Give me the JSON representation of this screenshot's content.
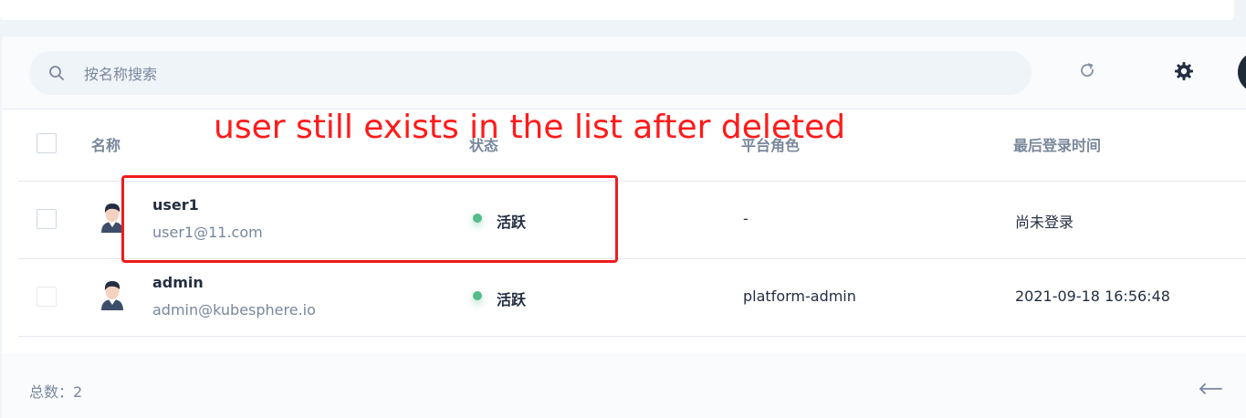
{
  "toolbar": {
    "search_placeholder": "按名称搜索"
  },
  "table": {
    "columns": [
      "名称",
      "状态",
      "平台角色",
      "最后登录时间"
    ],
    "rows": [
      {
        "name": "user1",
        "email": "user1@11.com",
        "status": "活跃",
        "role": "-",
        "last_login": "尚未登录"
      },
      {
        "name": "admin",
        "email": "admin@kubesphere.io",
        "status": "活跃",
        "role": "platform-admin",
        "last_login": "2021-09-18 16:56:48"
      }
    ]
  },
  "footer": {
    "total_label": "总数：2"
  },
  "annotation": {
    "text": "user still exists in the list after deleted",
    "color": "#ee1c1c"
  },
  "colors": {
    "status_active": "#55bc8a",
    "text_primary": "#242e42",
    "text_secondary": "#79879c"
  },
  "icons": [
    "search-icon",
    "refresh-icon",
    "gear-icon",
    "user-avatar-icon",
    "arrow-left-icon"
  ]
}
